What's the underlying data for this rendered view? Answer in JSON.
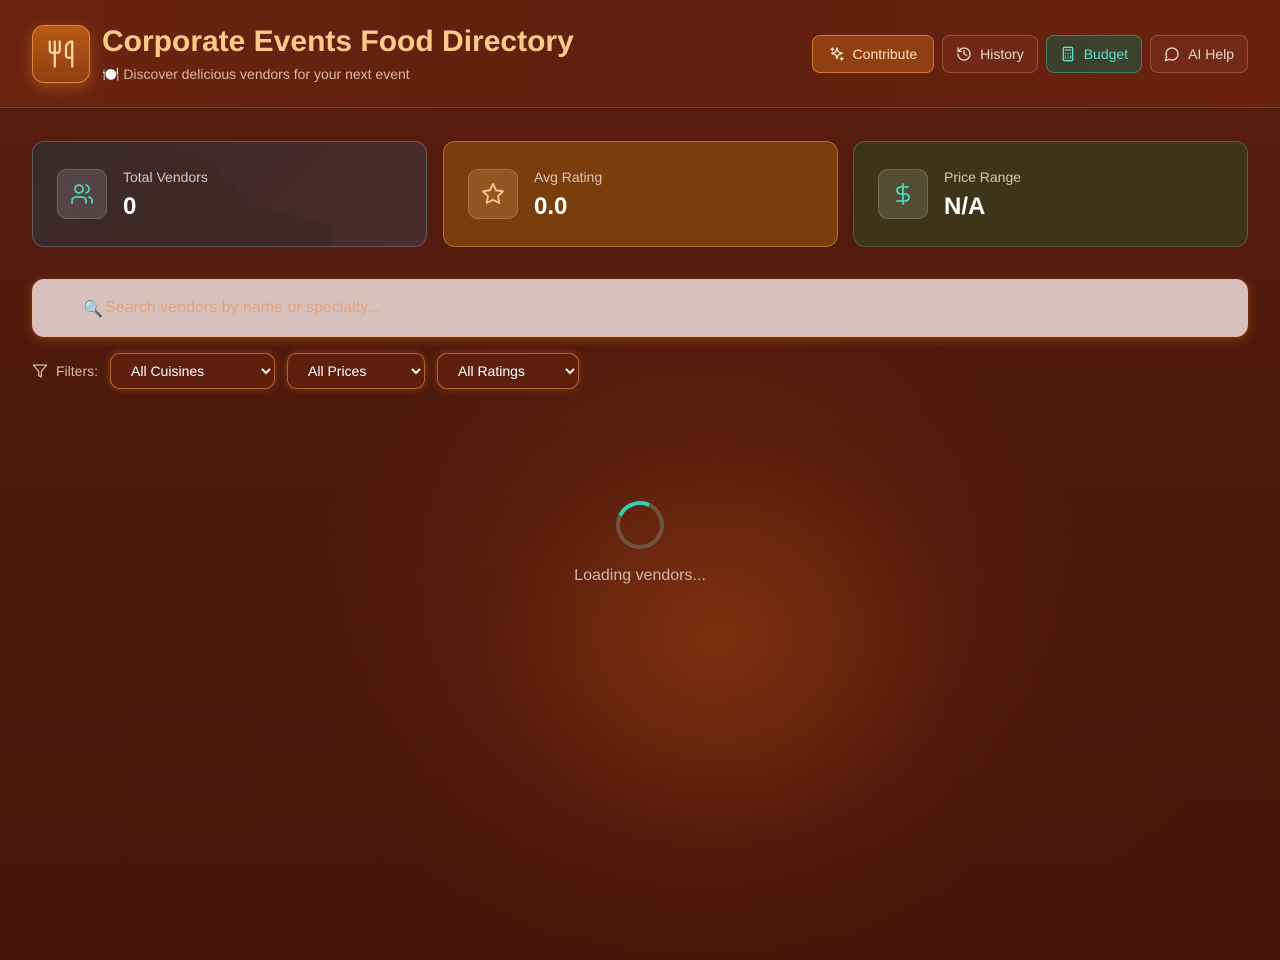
{
  "header": {
    "title": "Corporate Events Food Directory",
    "subtitle": "🍽️ Discover delicious vendors for your next event",
    "logo_icon": "utensils-icon"
  },
  "nav": {
    "contribute": "Contribute",
    "history": "History",
    "budget": "Budget",
    "ai_help": "AI Help"
  },
  "stats": {
    "total_vendors": {
      "label": "Total Vendors",
      "value": "0",
      "icon": "users-icon"
    },
    "avg_rating": {
      "label": "Avg Rating",
      "value": "0.0",
      "icon": "star-icon"
    },
    "price_range": {
      "label": "Price Range",
      "value": "N/A",
      "icon": "dollar-icon"
    }
  },
  "search": {
    "placeholder": "Search vendors by name or specialty...",
    "value": ""
  },
  "filters": {
    "label": "Filters:",
    "cuisine": "All Cuisines",
    "price": "All Prices",
    "rating": "All Ratings"
  },
  "loading": {
    "text": "Loading vendors..."
  },
  "colors": {
    "accent_orange": "#ffc98a",
    "accent_teal": "#2fd0b4",
    "background": "#4e1a0c"
  }
}
